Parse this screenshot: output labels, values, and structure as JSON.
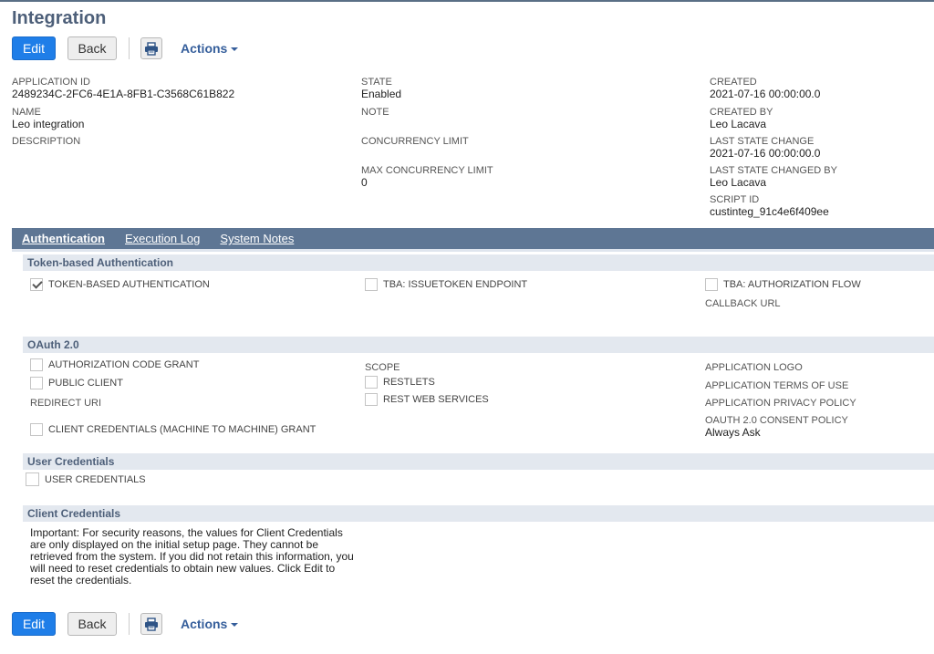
{
  "page": {
    "title": "Integration"
  },
  "toolbar": {
    "edit_label": "Edit",
    "back_label": "Back",
    "print_icon": "printer-icon",
    "actions_label": "Actions"
  },
  "header_fields": {
    "application_id": {
      "label": "APPLICATION ID",
      "value": "2489234C-2FC6-4E1A-8FB1-C3568C61B822"
    },
    "name": {
      "label": "NAME",
      "value": "Leo integration"
    },
    "description": {
      "label": "DESCRIPTION",
      "value": ""
    },
    "state": {
      "label": "STATE",
      "value": "Enabled"
    },
    "note": {
      "label": "NOTE",
      "value": ""
    },
    "concurrency_limit": {
      "label": "CONCURRENCY LIMIT",
      "value": ""
    },
    "max_concurrency_limit": {
      "label": "MAX CONCURRENCY LIMIT",
      "value": "0"
    },
    "created": {
      "label": "CREATED",
      "value": "2021-07-16 00:00:00.0"
    },
    "created_by": {
      "label": "CREATED BY",
      "value": "Leo Lacava"
    },
    "last_state_change": {
      "label": "LAST STATE CHANGE",
      "value": "2021-07-16 00:00:00.0"
    },
    "last_state_changed_by": {
      "label": "LAST STATE CHANGED BY",
      "value": "Leo Lacava"
    },
    "script_id": {
      "label": "SCRIPT ID",
      "value": "custinteg_91c4e6f409ee"
    }
  },
  "tabs": [
    {
      "label": "Authentication",
      "active": true
    },
    {
      "label": "Execution Log",
      "active": false
    },
    {
      "label": "System Notes",
      "active": false
    }
  ],
  "tba": {
    "header": "Token-based Authentication",
    "token_based_auth": {
      "label": "TOKEN-BASED AUTHENTICATION",
      "checked": true
    },
    "issuetoken_endpoint": {
      "label": "TBA: ISSUETOKEN ENDPOINT",
      "checked": false
    },
    "authorization_flow": {
      "label": "TBA: AUTHORIZATION FLOW",
      "checked": false
    },
    "callback_url_label": "CALLBACK URL"
  },
  "oauth": {
    "header": "OAuth 2.0",
    "auth_code_grant": {
      "label": "AUTHORIZATION CODE GRANT",
      "checked": false
    },
    "public_client": {
      "label": "PUBLIC CLIENT",
      "checked": false
    },
    "redirect_uri_label": "REDIRECT URI",
    "client_credentials_grant": {
      "label": "CLIENT CREDENTIALS (MACHINE TO MACHINE) GRANT",
      "checked": false
    },
    "scope_label": "SCOPE",
    "restlets": {
      "label": "RESTLETS",
      "checked": false
    },
    "rest_web_services": {
      "label": "REST WEB SERVICES",
      "checked": false
    },
    "application_logo_label": "APPLICATION LOGO",
    "terms_of_use_label": "APPLICATION TERMS OF USE",
    "privacy_policy_label": "APPLICATION PRIVACY POLICY",
    "consent_policy": {
      "label": "OAUTH 2.0 CONSENT POLICY",
      "value": "Always Ask"
    }
  },
  "user_credentials": {
    "header": "User Credentials",
    "checkbox": {
      "label": "USER CREDENTIALS",
      "checked": false
    }
  },
  "client_credentials": {
    "header": "Client Credentials",
    "note": "Important: For security reasons, the values for Client Credentials are only displayed on the initial setup page. They cannot be retrieved from the system. If you did not retain this information, you will need to reset credentials to obtain new values. Click Edit to reset the credentials."
  }
}
